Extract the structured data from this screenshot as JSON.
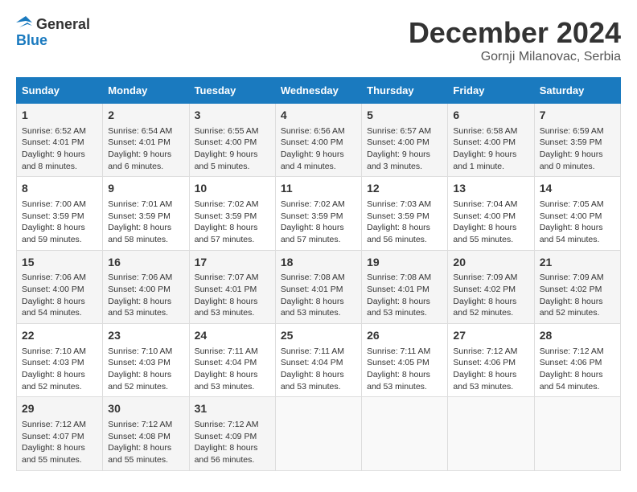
{
  "logo": {
    "text_general": "General",
    "text_blue": "Blue"
  },
  "header": {
    "month": "December 2024",
    "location": "Gornji Milanovac, Serbia"
  },
  "weekdays": [
    "Sunday",
    "Monday",
    "Tuesday",
    "Wednesday",
    "Thursday",
    "Friday",
    "Saturday"
  ],
  "weeks": [
    [
      {
        "day": "1",
        "sunrise": "6:52 AM",
        "sunset": "4:01 PM",
        "daylight": "9 hours and 8 minutes."
      },
      {
        "day": "2",
        "sunrise": "6:54 AM",
        "sunset": "4:01 PM",
        "daylight": "9 hours and 6 minutes."
      },
      {
        "day": "3",
        "sunrise": "6:55 AM",
        "sunset": "4:00 PM",
        "daylight": "9 hours and 5 minutes."
      },
      {
        "day": "4",
        "sunrise": "6:56 AM",
        "sunset": "4:00 PM",
        "daylight": "9 hours and 4 minutes."
      },
      {
        "day": "5",
        "sunrise": "6:57 AM",
        "sunset": "4:00 PM",
        "daylight": "9 hours and 3 minutes."
      },
      {
        "day": "6",
        "sunrise": "6:58 AM",
        "sunset": "4:00 PM",
        "daylight": "9 hours and 1 minute."
      },
      {
        "day": "7",
        "sunrise": "6:59 AM",
        "sunset": "3:59 PM",
        "daylight": "9 hours and 0 minutes."
      }
    ],
    [
      {
        "day": "8",
        "sunrise": "7:00 AM",
        "sunset": "3:59 PM",
        "daylight": "8 hours and 59 minutes."
      },
      {
        "day": "9",
        "sunrise": "7:01 AM",
        "sunset": "3:59 PM",
        "daylight": "8 hours and 58 minutes."
      },
      {
        "day": "10",
        "sunrise": "7:02 AM",
        "sunset": "3:59 PM",
        "daylight": "8 hours and 57 minutes."
      },
      {
        "day": "11",
        "sunrise": "7:02 AM",
        "sunset": "3:59 PM",
        "daylight": "8 hours and 57 minutes."
      },
      {
        "day": "12",
        "sunrise": "7:03 AM",
        "sunset": "3:59 PM",
        "daylight": "8 hours and 56 minutes."
      },
      {
        "day": "13",
        "sunrise": "7:04 AM",
        "sunset": "4:00 PM",
        "daylight": "8 hours and 55 minutes."
      },
      {
        "day": "14",
        "sunrise": "7:05 AM",
        "sunset": "4:00 PM",
        "daylight": "8 hours and 54 minutes."
      }
    ],
    [
      {
        "day": "15",
        "sunrise": "7:06 AM",
        "sunset": "4:00 PM",
        "daylight": "8 hours and 54 minutes."
      },
      {
        "day": "16",
        "sunrise": "7:06 AM",
        "sunset": "4:00 PM",
        "daylight": "8 hours and 53 minutes."
      },
      {
        "day": "17",
        "sunrise": "7:07 AM",
        "sunset": "4:01 PM",
        "daylight": "8 hours and 53 minutes."
      },
      {
        "day": "18",
        "sunrise": "7:08 AM",
        "sunset": "4:01 PM",
        "daylight": "8 hours and 53 minutes."
      },
      {
        "day": "19",
        "sunrise": "7:08 AM",
        "sunset": "4:01 PM",
        "daylight": "8 hours and 53 minutes."
      },
      {
        "day": "20",
        "sunrise": "7:09 AM",
        "sunset": "4:02 PM",
        "daylight": "8 hours and 52 minutes."
      },
      {
        "day": "21",
        "sunrise": "7:09 AM",
        "sunset": "4:02 PM",
        "daylight": "8 hours and 52 minutes."
      }
    ],
    [
      {
        "day": "22",
        "sunrise": "7:10 AM",
        "sunset": "4:03 PM",
        "daylight": "8 hours and 52 minutes."
      },
      {
        "day": "23",
        "sunrise": "7:10 AM",
        "sunset": "4:03 PM",
        "daylight": "8 hours and 52 minutes."
      },
      {
        "day": "24",
        "sunrise": "7:11 AM",
        "sunset": "4:04 PM",
        "daylight": "8 hours and 53 minutes."
      },
      {
        "day": "25",
        "sunrise": "7:11 AM",
        "sunset": "4:04 PM",
        "daylight": "8 hours and 53 minutes."
      },
      {
        "day": "26",
        "sunrise": "7:11 AM",
        "sunset": "4:05 PM",
        "daylight": "8 hours and 53 minutes."
      },
      {
        "day": "27",
        "sunrise": "7:12 AM",
        "sunset": "4:06 PM",
        "daylight": "8 hours and 53 minutes."
      },
      {
        "day": "28",
        "sunrise": "7:12 AM",
        "sunset": "4:06 PM",
        "daylight": "8 hours and 54 minutes."
      }
    ],
    [
      {
        "day": "29",
        "sunrise": "7:12 AM",
        "sunset": "4:07 PM",
        "daylight": "8 hours and 55 minutes."
      },
      {
        "day": "30",
        "sunrise": "7:12 AM",
        "sunset": "4:08 PM",
        "daylight": "8 hours and 55 minutes."
      },
      {
        "day": "31",
        "sunrise": "7:12 AM",
        "sunset": "4:09 PM",
        "daylight": "8 hours and 56 minutes."
      },
      null,
      null,
      null,
      null
    ]
  ],
  "labels": {
    "sunrise": "Sunrise: ",
    "sunset": "Sunset: ",
    "daylight": "Daylight: "
  }
}
